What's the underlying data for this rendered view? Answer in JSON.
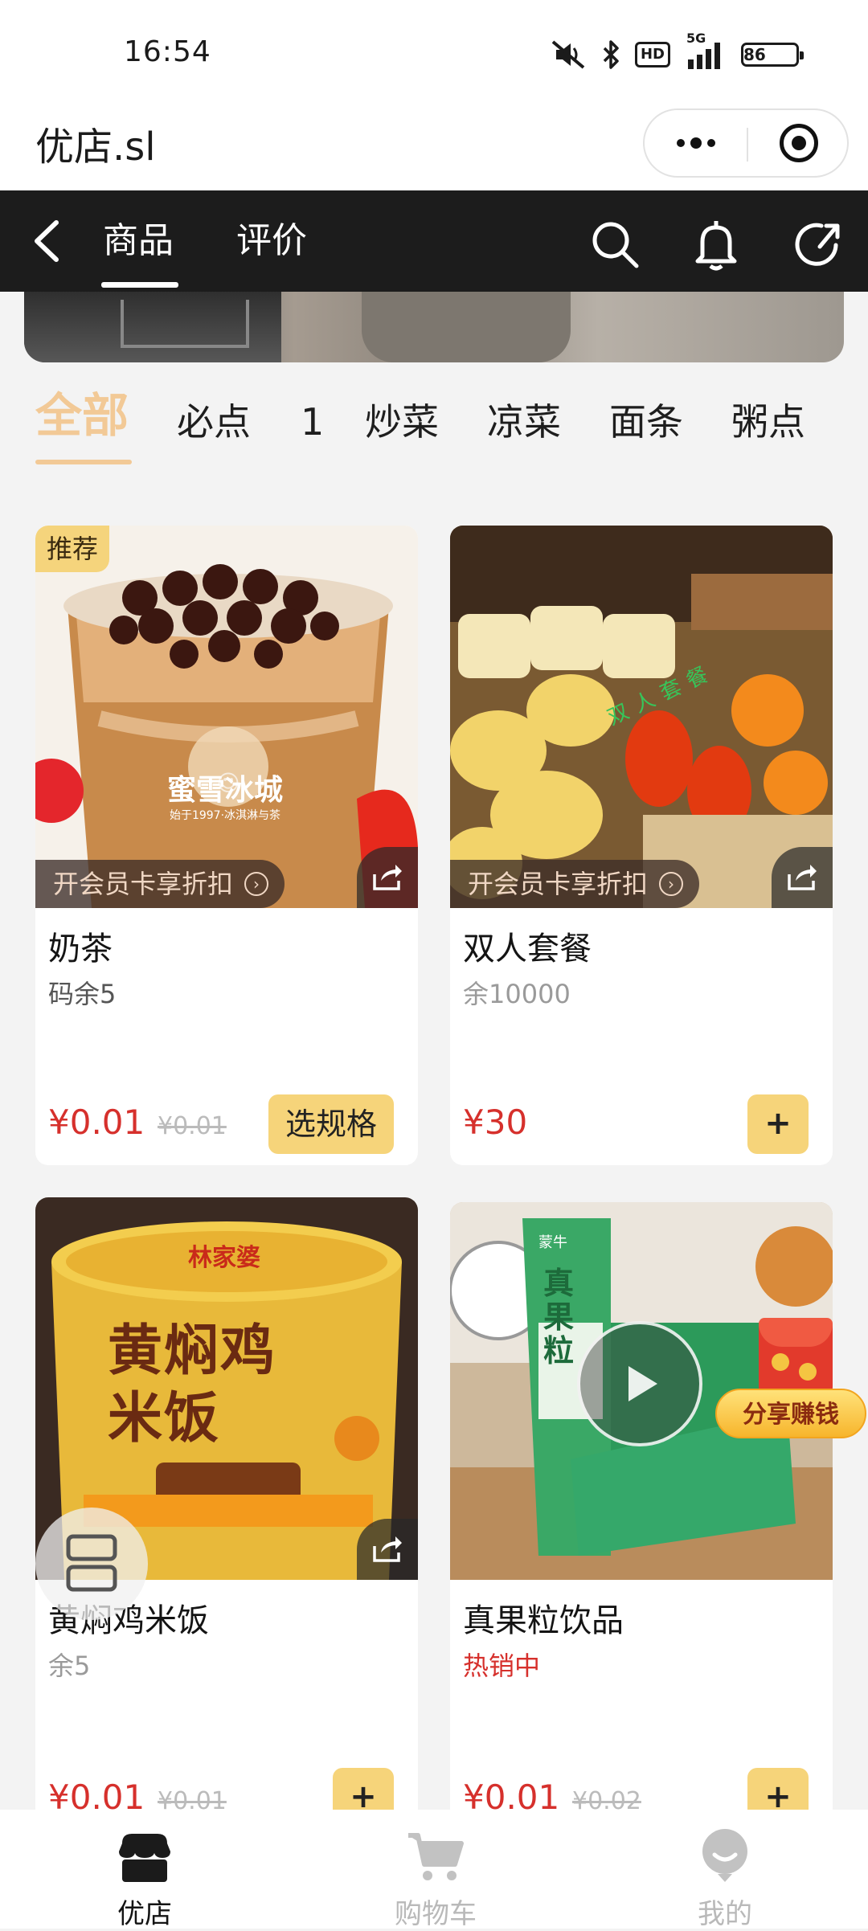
{
  "status_bar": {
    "time": "16:54",
    "network": "5G",
    "hd_label": "HD",
    "battery": "86",
    "icons": [
      "mute-icon",
      "bluetooth-icon",
      "hd-icon",
      "signal-icon",
      "battery-icon"
    ]
  },
  "mini_program": {
    "title": "优店.sl",
    "more_icon": "more-dots-icon",
    "close_icon": "target-close-icon"
  },
  "nav": {
    "tabs": [
      "商品",
      "评价"
    ],
    "active_tab": "商品",
    "icons": [
      "back-icon",
      "search-icon",
      "bell-icon",
      "share-icon"
    ]
  },
  "categories": {
    "items": [
      "全部",
      "必点",
      "1",
      "炒菜",
      "凉菜",
      "面条",
      "粥点"
    ],
    "active": "全部",
    "accent": "#f2c996"
  },
  "products": [
    {
      "title": "奶茶",
      "stock": "码余5",
      "price": "¥0.01",
      "original_price": "¥0.01",
      "action": "选规格",
      "badge": "推荐",
      "member_promo": "开会员卡享折扣",
      "image_text": "蜜雪冰城",
      "image_subtext": "始于1997·冰淇淋与茶"
    },
    {
      "title": "双人套餐",
      "stock": "余10000",
      "price": "¥30",
      "action": "+",
      "member_promo": "开会员卡享折扣",
      "image_text": "双人套餐"
    },
    {
      "title": "黄焖鸡米饭",
      "stock": "余5",
      "price": "¥0.01",
      "original_price": "¥0.01",
      "action": "+",
      "image_text": "黄焖鸡米饭",
      "image_brand": "林家婆"
    },
    {
      "title": "真果粒饮品",
      "stock": "热销中",
      "price": "¥0.01",
      "original_price": "¥0.02",
      "action": "+",
      "image_text": "真果粒",
      "image_brand": "蒙牛"
    }
  ],
  "floating": {
    "share_earn": "分享赚钱"
  },
  "tabbar": {
    "items": [
      {
        "label": "优店",
        "icon": "shop-icon",
        "active": true
      },
      {
        "label": "购物车",
        "icon": "cart-icon",
        "active": false
      },
      {
        "label": "我的",
        "icon": "profile-icon",
        "active": false
      }
    ]
  },
  "colors": {
    "price_red": "#d6302c",
    "button_yellow": "#f6d47a",
    "nav_dark": "#1c1c1c"
  }
}
